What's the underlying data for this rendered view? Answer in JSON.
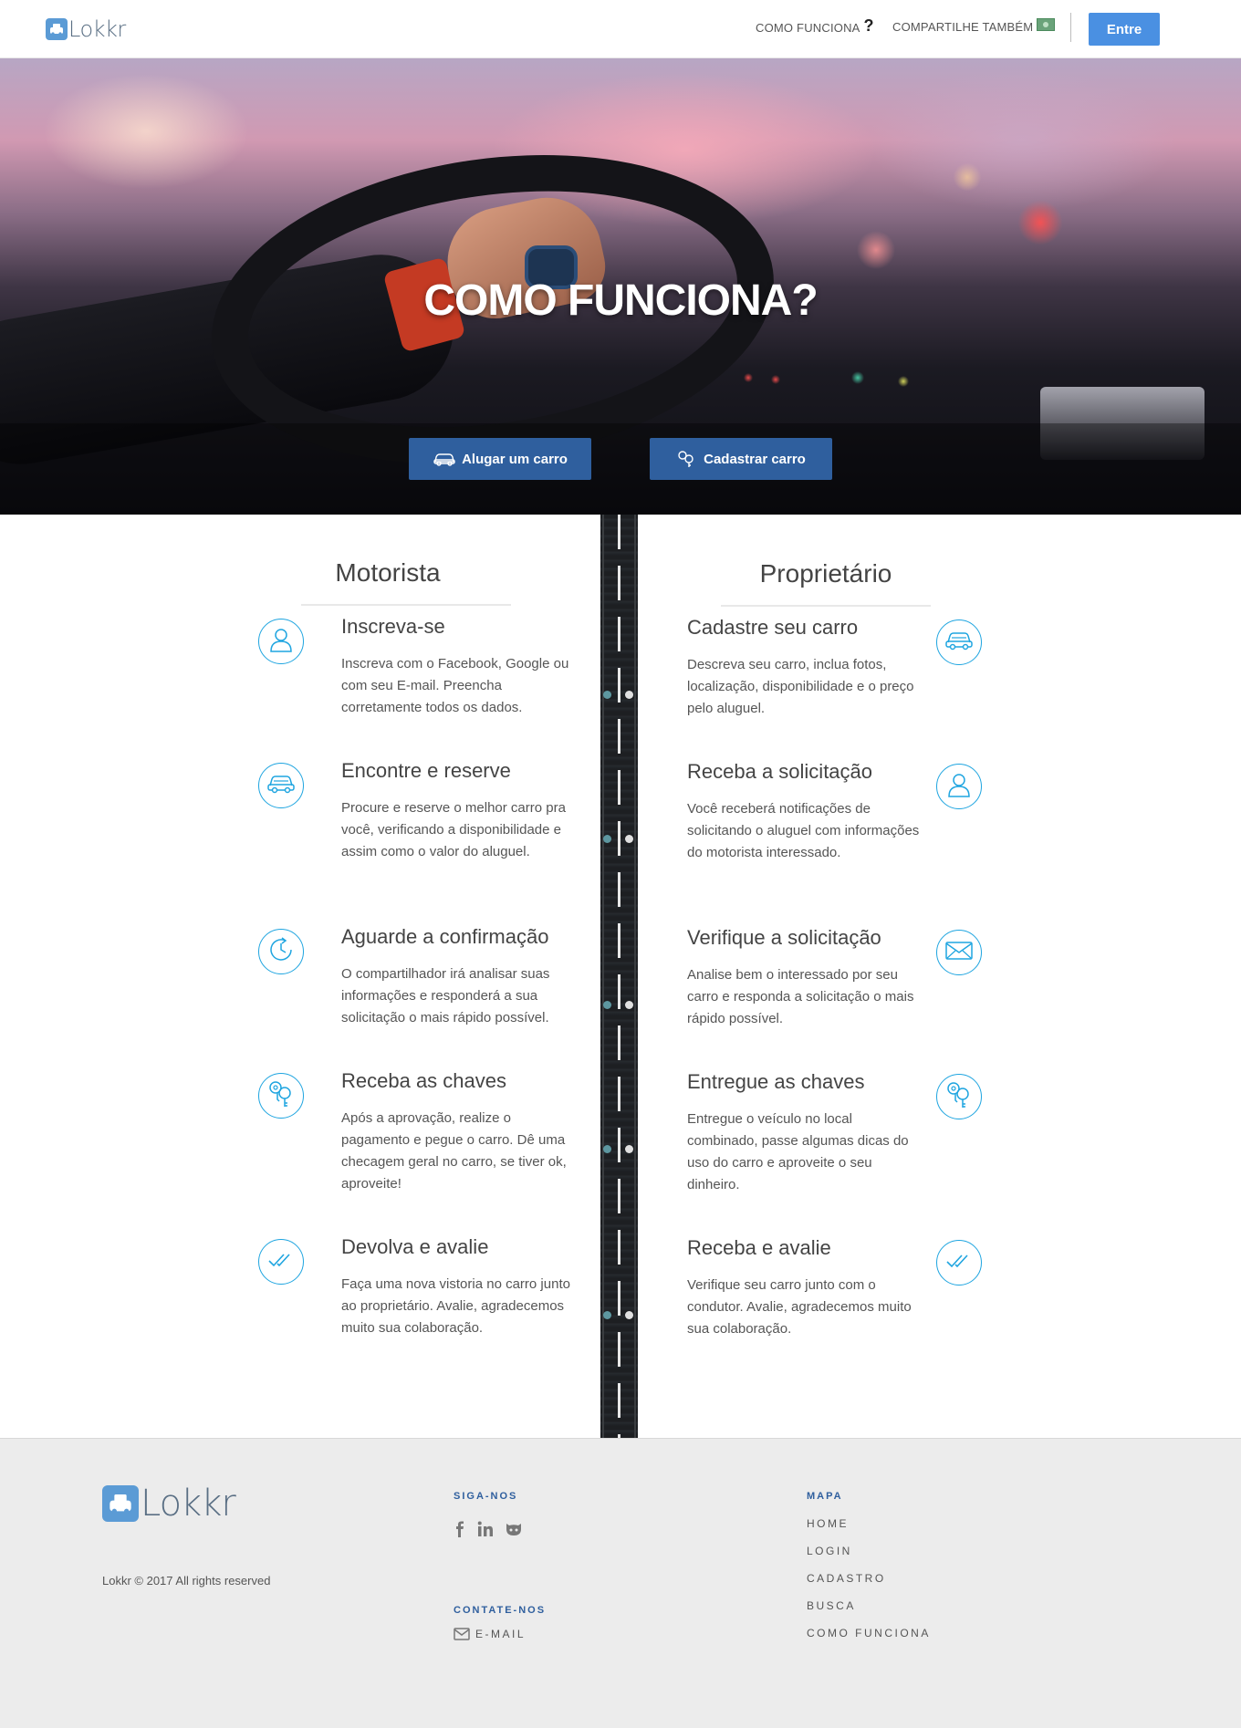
{
  "nav": {
    "brand": "Lokkr",
    "how_it_works": "COMO FUNCIONA",
    "share_too": "COMPARTILHE TAMBÉM",
    "login": "Entre"
  },
  "hero": {
    "title": "COMO FUNCIONA?",
    "rent_button": "Alugar um carro",
    "register_button": "Cadastrar carro"
  },
  "driver": {
    "title": "Motorista",
    "steps": [
      {
        "icon": "user-icon",
        "title": "Inscreva-se",
        "text": "Inscreva com o Facebook, Google ou com seu E-mail. Preencha corretamente todos os dados."
      },
      {
        "icon": "car-icon",
        "title": "Encontre e reserve",
        "text": "Procure e reserve o melhor carro pra você, verificando a disponibilidade e assim como o valor do aluguel."
      },
      {
        "icon": "clock-icon",
        "title": "Aguarde a confirmação",
        "text": "O compartilhador irá analisar suas informações e responderá a sua solicitação o mais rápido possível."
      },
      {
        "icon": "keys-icon",
        "title": "Receba as chaves",
        "text": "Após a aprovação, realize o pagamento e pegue o carro. Dê uma checagem geral no carro, se tiver ok, aproveite!"
      },
      {
        "icon": "double-check-icon",
        "title": "Devolva e avalie",
        "text": "Faça uma nova vistoria no carro junto ao proprietário. Avalie, agradecemos muito sua colaboração."
      }
    ]
  },
  "owner": {
    "title": "Proprietário",
    "steps": [
      {
        "icon": "car-icon",
        "title": "Cadastre seu carro",
        "text": "Descreva seu carro, inclua fotos, localização, disponibilidade e o preço pelo aluguel."
      },
      {
        "icon": "user-icon",
        "title": "Receba a solicitação",
        "text": "Você receberá notificações de solicitando o aluguel com informações do motorista interessado."
      },
      {
        "icon": "envelope-icon",
        "title": "Verifique a solicitação",
        "text": "Analise bem o interessado por seu carro e responda a solicitação o mais rápido possível."
      },
      {
        "icon": "keys-icon",
        "title": "Entregue as chaves",
        "text": "Entregue o veículo no local combinado, passe algumas dicas do uso do carro e aproveite o seu dinheiro."
      },
      {
        "icon": "double-check-icon",
        "title": "Receba e avalie",
        "text": "Verifique seu carro junto com o condutor. Avalie, agradecemos muito sua colaboração."
      }
    ]
  },
  "footer": {
    "brand": "Lokkr",
    "copyright": "Lokkr © 2017 All rights reserved",
    "follow_title": "SIGA-NOS",
    "social_icons": [
      "facebook-icon",
      "linkedin-icon",
      "github-icon"
    ],
    "contact_title": "CONTATE-NOS",
    "email_label": "E-MAIL",
    "map_title": "MAPA",
    "map_links": [
      "HOME",
      "LOGIN",
      "CADASTRO",
      "BUSCA",
      "COMO FUNCIONA"
    ]
  },
  "colors": {
    "accent": "#4a90e2",
    "hero_button": "#2f5f9e",
    "icon_stroke": "#1fa5e0",
    "footer_bg": "#ececec"
  }
}
